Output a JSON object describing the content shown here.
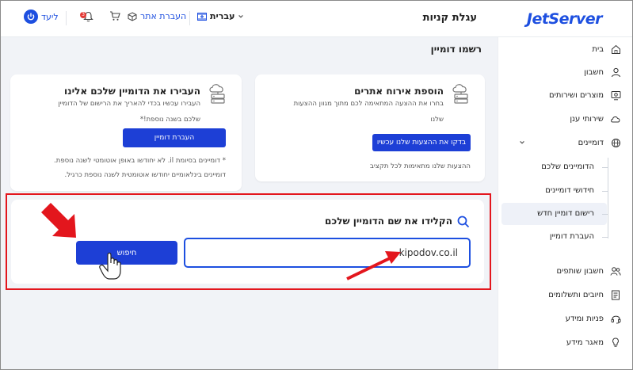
{
  "header": {
    "brand": "JetServer",
    "page_heading": "עגלת קניות",
    "language": "עברית",
    "transfer_other": "העברת אתר",
    "notifications_count": "3",
    "login": "ליעד"
  },
  "sidebar": {
    "items": [
      {
        "label": "בית",
        "icon": "home-icon"
      },
      {
        "label": "חשבון",
        "icon": "user-icon"
      },
      {
        "label": "מוצרים ושירותים",
        "icon": "monitor-icon"
      },
      {
        "label": "שירותי ענן",
        "icon": "cloud-icon"
      },
      {
        "label": "דומיינים",
        "icon": "globe-icon"
      }
    ],
    "sub_items": [
      {
        "label": "הדומיינים שלכם"
      },
      {
        "label": "חידושי דומיינים"
      },
      {
        "label": "רישום דומיין חדש",
        "active": true
      },
      {
        "label": "העברת דומיין"
      }
    ],
    "bottom_items": [
      {
        "label": "חשבון שותפים",
        "icon": "users-icon"
      },
      {
        "label": "חיובים ותשלומים",
        "icon": "document-icon"
      },
      {
        "label": "פניות ומידע",
        "icon": "headset-icon"
      },
      {
        "label": "מאגר מידע",
        "icon": "bulb-icon"
      }
    ]
  },
  "main": {
    "title": "רשמו דומיין",
    "hosting_card": {
      "title": "הוספת אירוח אתרים",
      "line1": "בחרו את ההצעה המתאימה לכם מתוך מגוון ההצעות",
      "line2": "שלנו",
      "button": "בדקו את ההצעות שלנו עכשיו",
      "footer": "ההצעות שלנו מתאימות לכל תקציב"
    },
    "transfer_card": {
      "title": "העבירו את הדומיין שלכם אלינו",
      "line1": "העבירו עכשיו בכדי להאריך את הרישום של הדומיין",
      "line2": "שלכם בשנה נוספת!*",
      "button": "העברת דומיין",
      "note1": "* דומיינים בסיומת il. לא יחודשו באופן אוטומטי לשנה נוספת.",
      "note2": "דומיינים בינלאומיים יחודשו אוטומטית לשנה נוספת כרגיל."
    },
    "search": {
      "title": "הקלידו את שם הדומיין שלכם",
      "value": "kipodov.co.il",
      "button": "חיפוש"
    }
  },
  "colors": {
    "accent": "#1d3fd6",
    "brand": "#1d4fe0",
    "annotation": "#e3161d"
  }
}
